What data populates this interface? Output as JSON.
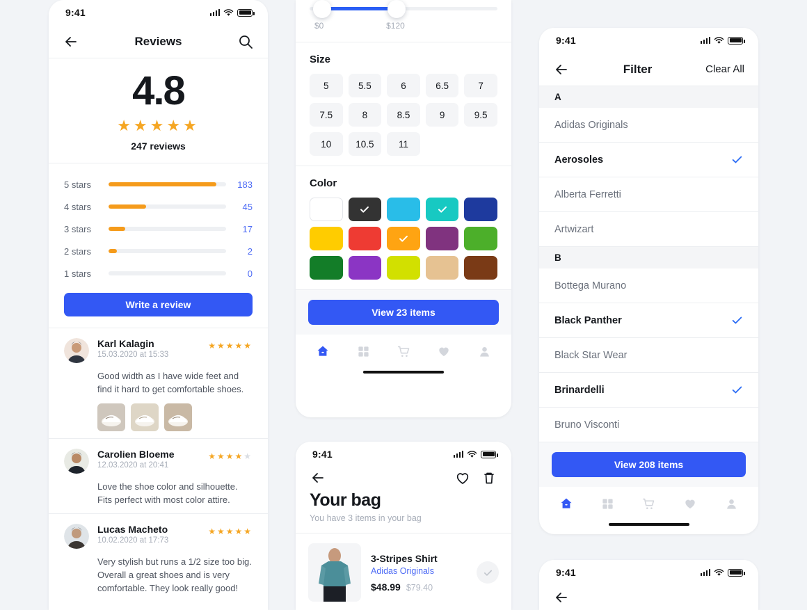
{
  "status_bar": {
    "time": "9:41"
  },
  "reviews_screen": {
    "nav": {
      "title": "Reviews",
      "back_icon": "back-arrow-icon",
      "search_icon": "search-icon"
    },
    "summary": {
      "score": "4.8",
      "stars": 5,
      "count_label": "247 reviews"
    },
    "distribution": [
      {
        "label": "5 stars",
        "value": "183",
        "percent": 92
      },
      {
        "label": "4 stars",
        "value": "45",
        "percent": 32
      },
      {
        "label": "3 stars",
        "value": "17",
        "percent": 14
      },
      {
        "label": "2 stars",
        "value": "2",
        "percent": 7
      },
      {
        "label": "1 stars",
        "value": "0",
        "percent": 0
      }
    ],
    "write_review_label": "Write a review",
    "accent_blue": "#3358f4",
    "star_orange": "#F5A623",
    "bar_orange": "#F59B1B",
    "items": [
      {
        "name": "Karl Kalagin",
        "date": "15.03.2020 at 15:33",
        "rating": 5,
        "text": "Good width as I have wide feet and find it hard to get comfortable shoes.",
        "thumbs": 3
      },
      {
        "name": "Carolien Bloeme",
        "date": "12.03.2020 at 20:41",
        "rating": 4,
        "text": "Love the shoe color and silhouette. Fits perfect with most color attire.",
        "thumbs": 0
      },
      {
        "name": "Lucas Macheto",
        "date": "10.02.2020 at 17:73",
        "rating": 5,
        "text": "Very stylish but runs a 1/2 size too big. Overall a great shoes and is very comfortable. They look really good!",
        "thumbs": 0
      }
    ]
  },
  "filter_screen": {
    "price": {
      "min_label": "$0",
      "max_label": "$120",
      "fill_start_pct": 10,
      "fill_end_pct": 43
    },
    "size": {
      "title": "Size",
      "options": [
        "5",
        "5.5",
        "6",
        "6.5",
        "7",
        "7.5",
        "8",
        "8.5",
        "9",
        "9.5",
        "10",
        "10.5",
        "11"
      ]
    },
    "color": {
      "title": "Color",
      "swatches": [
        {
          "hex": "#ffffff",
          "selected": false,
          "border": true
        },
        {
          "hex": "#333333",
          "selected": true,
          "border": false
        },
        {
          "hex": "#29bde8",
          "selected": false,
          "border": false
        },
        {
          "hex": "#17c9c2",
          "selected": true,
          "border": false
        },
        {
          "hex": "#1e3a9e",
          "selected": false,
          "border": false
        },
        {
          "hex": "#ffcc00",
          "selected": false,
          "border": false
        },
        {
          "hex": "#ee3b33",
          "selected": false,
          "border": false
        },
        {
          "hex": "#ffa412",
          "selected": true,
          "border": false
        },
        {
          "hex": "#80337f",
          "selected": false,
          "border": false
        },
        {
          "hex": "#4caf2a",
          "selected": false,
          "border": false
        },
        {
          "hex": "#137d28",
          "selected": false,
          "border": false
        },
        {
          "hex": "#8b35c4",
          "selected": false,
          "border": false
        },
        {
          "hex": "#d2e000",
          "selected": false,
          "border": false
        },
        {
          "hex": "#e6c292",
          "selected": false,
          "border": false
        },
        {
          "hex": "#7a3a16",
          "selected": false,
          "border": false
        }
      ]
    },
    "cta_label": "View 23 items",
    "tabs": [
      "home-icon",
      "grid-icon",
      "cart-icon",
      "heart-icon",
      "profile-icon"
    ],
    "active_tab": 0
  },
  "bag_screen": {
    "title": "Your bag",
    "subtitle": "You have 3 items in your bag",
    "heart_icon": "heart-outline-icon",
    "trash_icon": "trash-icon",
    "item": {
      "name": "3-Stripes Shirt",
      "brand": "Adidas Originals",
      "price": "$48.99",
      "old_price": "$79.40",
      "check_icon": "check-icon"
    }
  },
  "brands_screen": {
    "nav": {
      "title": "Filter",
      "clear_label": "Clear All",
      "back_icon": "back-arrow-icon"
    },
    "groups": [
      {
        "letter": "A",
        "brands": [
          {
            "name": "Adidas Originals",
            "selected": false
          },
          {
            "name": "Aerosoles",
            "selected": true
          },
          {
            "name": "Alberta Ferretti",
            "selected": false
          },
          {
            "name": "Artwizart",
            "selected": false
          }
        ]
      },
      {
        "letter": "B",
        "brands": [
          {
            "name": "Bottega Murano",
            "selected": false
          },
          {
            "name": "Black Panther",
            "selected": true
          },
          {
            "name": "Black Star Wear",
            "selected": false
          },
          {
            "name": "Brinardelli",
            "selected": true
          },
          {
            "name": "Bruno Visconti",
            "selected": false
          }
        ]
      }
    ],
    "cta_label": "View 208 items",
    "tabs": [
      "home-icon",
      "grid-icon",
      "cart-icon",
      "heart-icon",
      "profile-icon"
    ],
    "active_tab": 0
  }
}
